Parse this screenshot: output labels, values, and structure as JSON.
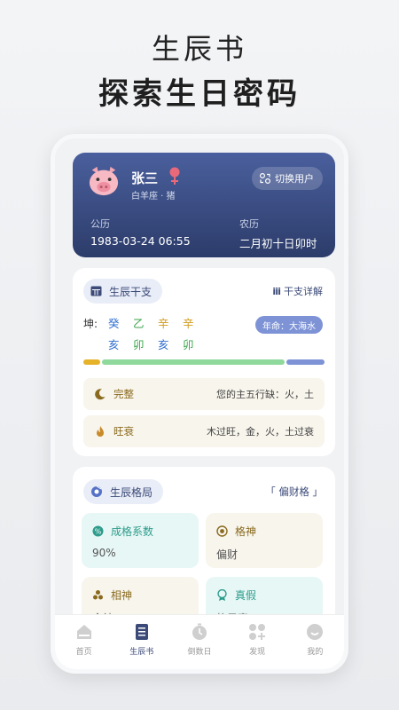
{
  "hero": {
    "title": "生辰书",
    "subtitle": "探索生日密码"
  },
  "profile": {
    "name": "张三",
    "zodiac": "白羊座 · 猪",
    "switch_label": "切换用户",
    "gregorian_label": "公历",
    "gregorian_value": "1983-03-24 06:55",
    "lunar_label": "农历",
    "lunar_value": "二月初十日卯时"
  },
  "ganzhi": {
    "title": "生辰干支",
    "detail_link": "干支详解",
    "kun_label": "坤:",
    "stems": [
      "癸",
      "乙",
      "辛",
      "辛"
    ],
    "branches": [
      "亥",
      "卯",
      "亥",
      "卯"
    ],
    "stem_colors": [
      "#2f6fd1",
      "#3aa34a",
      "#d19a1b",
      "#d19a1b"
    ],
    "branch_colors": [
      "#2f6fd1",
      "#3aa34a",
      "#2f6fd1",
      "#3aa34a"
    ],
    "fate_badge": "年命：大海水",
    "element_bar": [
      {
        "color": "#e5b22a",
        "share": 0.07
      },
      {
        "color": "#8ed99b",
        "share": 0.77
      },
      {
        "color": "#7d93d6",
        "share": 0.16
      }
    ],
    "complete_label": "完整",
    "complete_value": "您的主五行缺：火，土",
    "wangshuai_label": "旺衰",
    "wangshuai_value": "木过旺，金，火，土过衰"
  },
  "geju": {
    "title": "生辰格局",
    "pattern": "「 偏财格 」",
    "tiles": [
      {
        "label": "成格系数",
        "value": "90%",
        "bg": "#e7f7f5",
        "color": "#2e9c8c"
      },
      {
        "label": "格神",
        "value": "偏财",
        "bg": "#f7f5ec",
        "color": "#8a6a1f"
      },
      {
        "label": "相神",
        "value": "食神",
        "bg": "#f7f5ec",
        "color": "#8a6a1f"
      },
      {
        "label": "真假",
        "value": "格局真",
        "bg": "#e7f7f5",
        "color": "#2e9c8c"
      }
    ]
  },
  "tabs": [
    {
      "label": "首页"
    },
    {
      "label": "生辰书"
    },
    {
      "label": "倒数日"
    },
    {
      "label": "发现"
    },
    {
      "label": "我的"
    }
  ],
  "colors": {
    "accent": "#3b4a78",
    "header_top": "#4a5f9d",
    "header_bottom": "#2c3c6a",
    "gender_icon": "#e86a7a"
  }
}
